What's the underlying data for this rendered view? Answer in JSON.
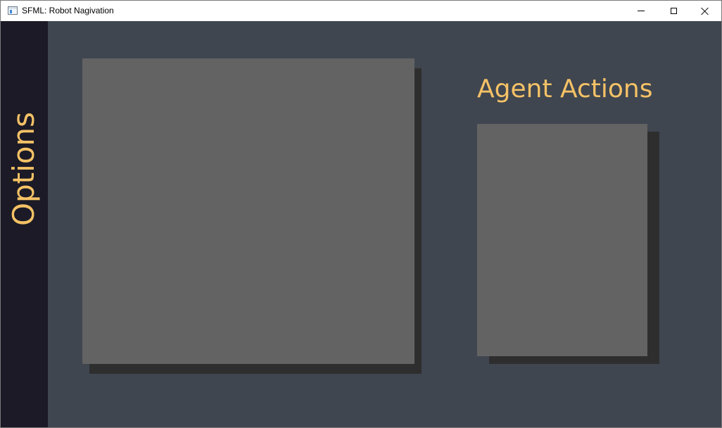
{
  "window": {
    "title": "SFML: Robot Nagivation"
  },
  "sidebar": {
    "label": "Options"
  },
  "actions": {
    "title": "Agent Actions"
  },
  "colors": {
    "background": "#3f4650",
    "sidebar": "#1b1a26",
    "panel": "#636363",
    "panel_shadow": "#2e2e2e",
    "accent_text": "#f5c266"
  },
  "icons": {
    "app": "app-window-icon",
    "minimize": "minimize-icon",
    "maximize": "maximize-icon",
    "close": "close-icon"
  }
}
